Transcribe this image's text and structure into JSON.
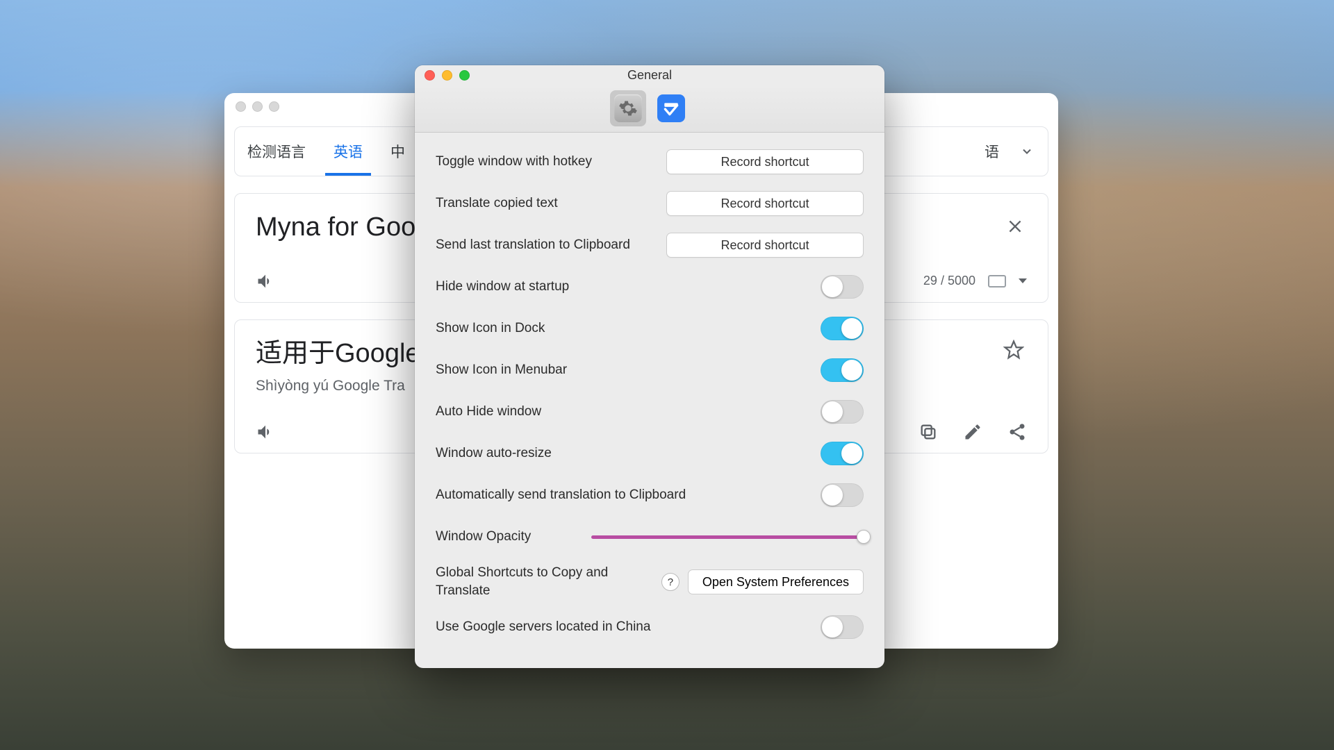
{
  "translate": {
    "source_tabs": [
      "检测语言",
      "英语",
      "中"
    ],
    "target_tabs": [
      "语"
    ],
    "source_text": "Myna for Google",
    "result_text": "适用于Google",
    "transliteration": "Shìyòng yú Google Tra",
    "char_count": "29 / 5000"
  },
  "prefs": {
    "title": "General",
    "record_shortcut": "Record shortcut",
    "system_prefs_button": "Open System Preferences",
    "rows": [
      {
        "label": "Toggle window with hotkey",
        "type": "shortcut"
      },
      {
        "label": "Translate copied text",
        "type": "shortcut"
      },
      {
        "label": "Send last translation to Clipboard",
        "type": "shortcut"
      },
      {
        "label": "Hide window at startup",
        "type": "toggle",
        "value": false
      },
      {
        "label": "Show Icon in Dock",
        "type": "toggle",
        "value": true
      },
      {
        "label": "Show Icon in Menubar",
        "type": "toggle",
        "value": true
      },
      {
        "label": "Auto Hide window",
        "type": "toggle",
        "value": false
      },
      {
        "label": "Window auto-resize",
        "type": "toggle",
        "value": true
      },
      {
        "label": "Automatically send translation to Clipboard",
        "type": "toggle",
        "value": false
      },
      {
        "label": "Window Opacity",
        "type": "slider",
        "value": 1.0
      },
      {
        "label": "Global Shortcuts to Copy and Translate",
        "type": "button"
      },
      {
        "label": "Use Google servers located in China",
        "type": "toggle",
        "value": false
      }
    ]
  }
}
